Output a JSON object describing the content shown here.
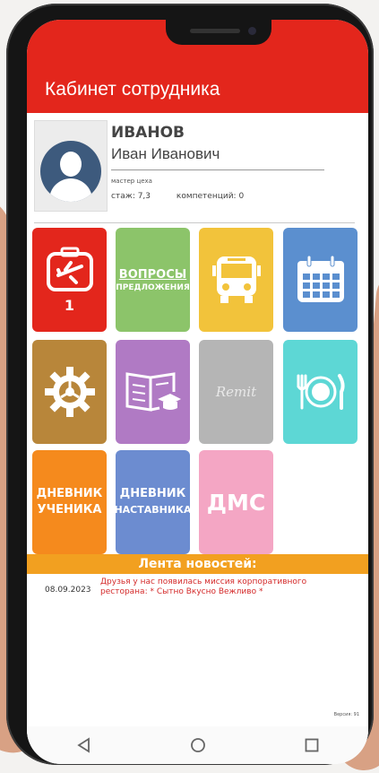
{
  "header": {
    "title": "Кабинет сотрудника"
  },
  "profile": {
    "surname": "ИВАНОВ",
    "given_names": "Иван Иванович",
    "position": "мастер цеха",
    "experience": "стаж: 7,3",
    "competencies": "компетенций: 0"
  },
  "tiles": {
    "trips": {
      "icon": "airplane-suitcase-icon",
      "count": "1"
    },
    "questions": {
      "line1": "ВОПРОСЫ",
      "line2": "ПРЕДЛОЖЕНИЯ"
    },
    "transport": {
      "icon": "bus-icon"
    },
    "calendar": {
      "icon": "calendar-icon"
    },
    "settings": {
      "icon": "gear-icon"
    },
    "education": {
      "icon": "book-graduation-icon"
    },
    "remit": {
      "text": "Remit"
    },
    "dining": {
      "icon": "plate-fork-knife-icon"
    },
    "student_diary": {
      "line1": "ДНЕВНИК",
      "line2": "УЧЕНИКА"
    },
    "mentor_diary": {
      "line1": "ДНЕВНИК",
      "line2": "НАСТАВНИКА"
    },
    "dms": {
      "label": "ДМС"
    }
  },
  "news": {
    "title": "Лента новостей:",
    "items": [
      {
        "date": "08.09.2023",
        "text": "Друзья у нас появилась миссия корпоративного ресторана: * Сытно Вкусно Вежливо *"
      }
    ]
  },
  "footer": {
    "version": "Версия: 91"
  },
  "colors": {
    "header": "#e3261c",
    "news_bar": "#f2a020"
  }
}
